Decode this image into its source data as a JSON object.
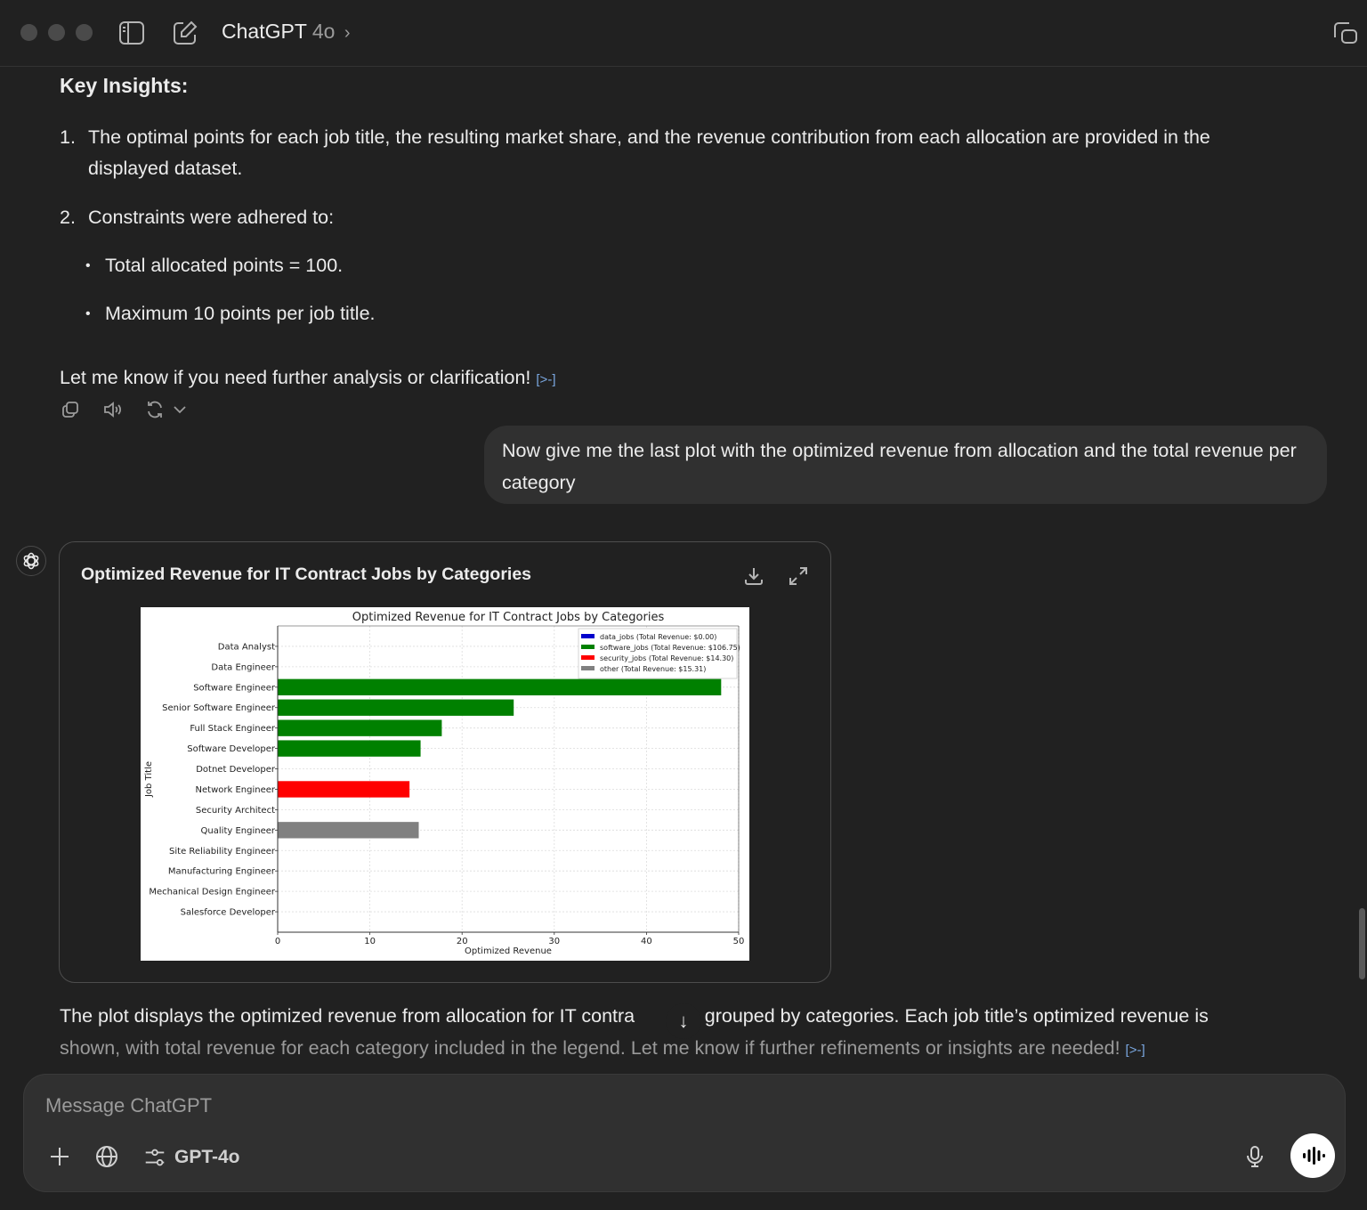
{
  "header": {
    "app_name": "ChatGPT",
    "model": "4o",
    "chevron": "›"
  },
  "assistant_1": {
    "heading": "Key Insights:",
    "list": [
      {
        "num": "1.",
        "text": "The optimal points for each job title, the resulting market share, and the revenue contribution from each allocation are provided in the"
      },
      {
        "num": "",
        "text": "displayed dataset."
      },
      {
        "num": "2.",
        "text": "Constraints were adhered to:"
      }
    ],
    "bullets": [
      "Total allocated points = 100.",
      "Maximum 10 points per job title."
    ],
    "closing": "Let me know if you need further analysis or clarification!",
    "cite_glyph": "[>-]"
  },
  "user_message": {
    "text": "Now give me the last plot with the optimized revenue from allocation and the total revenue per category"
  },
  "chart_card": {
    "title": "Optimized Revenue for IT Contract Jobs by Categories"
  },
  "chart_data": {
    "type": "bar",
    "orientation": "horizontal",
    "title": "Optimized Revenue for IT Contract Jobs by Categories",
    "xlabel": "Optimized Revenue",
    "ylabel": "Job Title",
    "xlim": [
      0,
      50
    ],
    "xticks": [
      "0",
      "10",
      "20",
      "30",
      "40",
      "50"
    ],
    "grid": true,
    "legend_position": "top-right",
    "categories": [
      "Data Analyst",
      "Data Engineer",
      "Software Engineer",
      "Senior Software Engineer",
      "Full Stack Engineer",
      "Software Developer",
      "Dotnet Developer",
      "Network Engineer",
      "Security Architect",
      "Quality Engineer",
      "Site Reliability Engineer",
      "Manufacturing Engineer",
      "Mechanical Design Engineer",
      "Salesforce Developer"
    ],
    "values": [
      0,
      0,
      48.1,
      25.6,
      17.8,
      15.5,
      0,
      14.3,
      0,
      15.3,
      0,
      0,
      0,
      0
    ],
    "bar_groups": [
      "data_jobs",
      "data_jobs",
      "software_jobs",
      "software_jobs",
      "software_jobs",
      "software_jobs",
      "software_jobs",
      "security_jobs",
      "security_jobs",
      "other",
      "other",
      "other",
      "other",
      "other"
    ],
    "legend": [
      {
        "group": "data_jobs",
        "label": "data_jobs (Total Revenue: $0.00)",
        "color": "#0000cc"
      },
      {
        "group": "software_jobs",
        "label": "software_jobs (Total Revenue: $106.75)",
        "color": "#008000"
      },
      {
        "group": "security_jobs",
        "label": "security_jobs (Total Revenue: $14.30)",
        "color": "#ff0000"
      },
      {
        "group": "other",
        "label": "other (Total Revenue: $15.31)",
        "color": "#808080"
      }
    ]
  },
  "assistant_2": {
    "line1_a": "The plot displays the optimized revenue from allocation for IT contra",
    "line1_b": "bs, grouped by categories. Each job title’s optimized revenue is",
    "line2": "shown, with total revenue for each category included in the legend. Let me know if further refinements or insights are needed!",
    "cite_glyph": "[>-]"
  },
  "scroll_down_glyph": "↓",
  "composer": {
    "placeholder": "Message ChatGPT",
    "model_label": "GPT-4o"
  }
}
